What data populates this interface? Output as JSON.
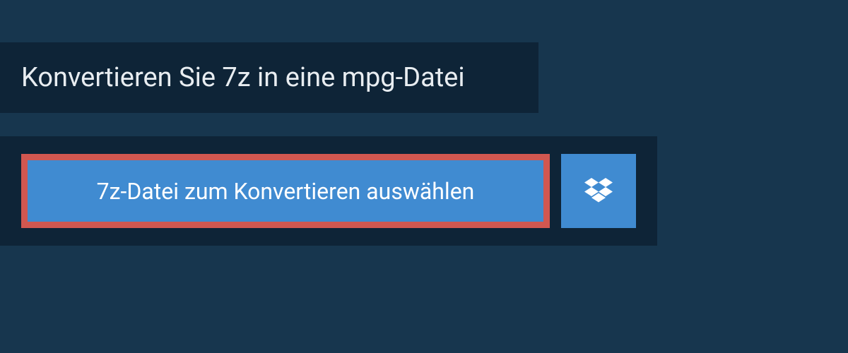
{
  "title": "Konvertieren Sie 7z in eine mpg-Datei",
  "selectButton": "7z-Datei zum Konvertieren auswählen"
}
